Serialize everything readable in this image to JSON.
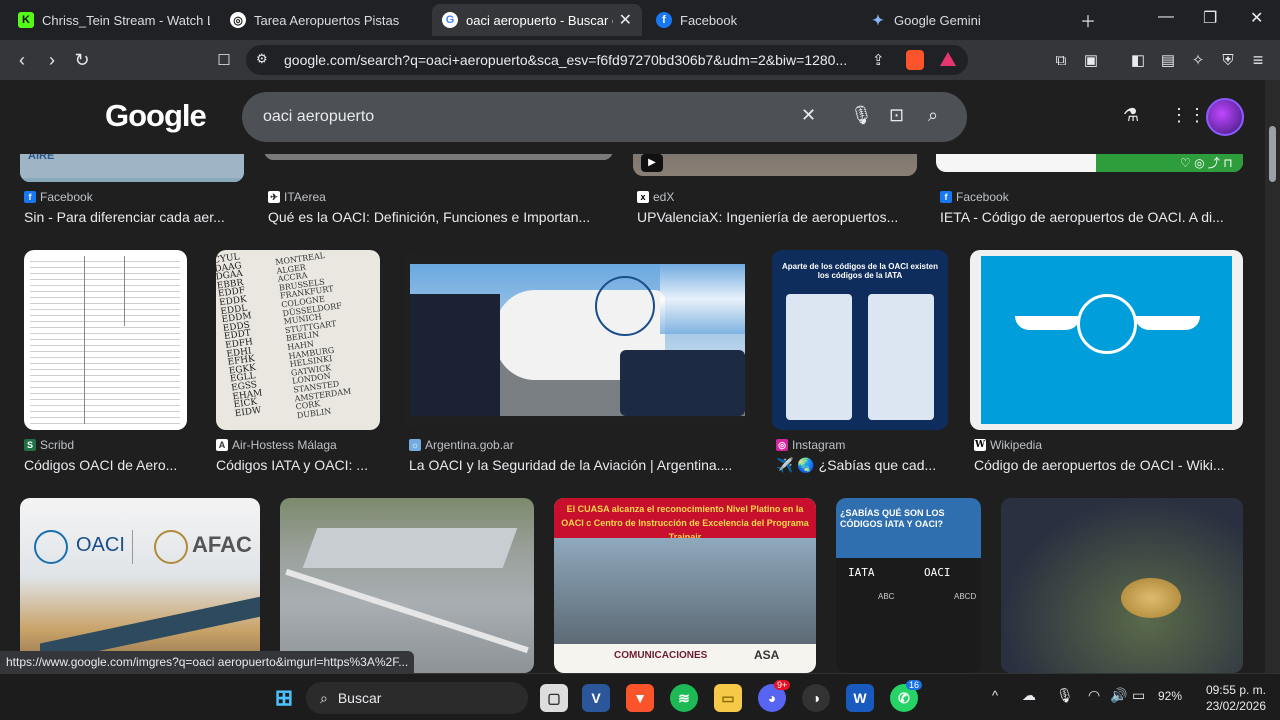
{
  "browser": {
    "tabs": [
      {
        "title": "Chriss_Tein Stream - Watch Live",
        "icon": "kick-icon",
        "active": false
      },
      {
        "title": "Tarea Aeropuertos Pistas",
        "icon": "docs-icon",
        "active": false
      },
      {
        "title": "oaci aeropuerto - Buscar con Google",
        "icon": "google-icon",
        "active": true
      },
      {
        "title": "Facebook",
        "icon": "facebook-icon",
        "active": false
      },
      {
        "title": "Google Gemini",
        "icon": "gemini-icon",
        "active": false
      }
    ],
    "url": "google.com/search?q=oaci+aeropuerto&sca_esv=f6fd97270bd306b7&udm=2&biw=1280...",
    "status_url": "https://www.google.com/imgres?q=oaci aeropuerto&imgurl=https%3A%2F..."
  },
  "google": {
    "logo": "Google",
    "query": "oaci aeropuerto"
  },
  "results": {
    "row1": [
      {
        "source": "Facebook",
        "caption": "Sin - Para diferenciar cada aer..."
      },
      {
        "source": "ITAerea",
        "caption": "Qué es la OACI: Definición, Funciones e Importan..."
      },
      {
        "source": "edX",
        "caption": "UPValenciaX: Ingeniería de aeropuertos..."
      },
      {
        "source": "Facebook",
        "caption": "IETA - Código de aeropuertos de OACI. A di..."
      }
    ],
    "row2": [
      {
        "source": "Scribd",
        "caption": "Códigos OACI de Aero..."
      },
      {
        "source": "Air-Hostess Málaga",
        "caption": "Códigos IATA y OACI: ..."
      },
      {
        "source": "Argentina.gob.ar",
        "caption": "La OACI y la Seguridad de la Aviación | Argentina...."
      },
      {
        "source": "Instagram",
        "caption": "✈️ 🌏 ¿Sabías que cad..."
      },
      {
        "source": "Wikipedia",
        "caption": "Código de aeropuertos de OACI - Wiki..."
      }
    ],
    "thumb_text": {
      "aire": "AIRE",
      "oaci": "OACI",
      "afac": "AFAC",
      "cuasa_banner": "El CUASA alcanza el reconocimiento Nivel Platino en la OACI c Centro de Instrucción de Excelencia del Programa Trainair",
      "comunicaciones": "COMUNICACIONES",
      "asa": "ASA",
      "sabias": "¿SABÍAS QUÉ SON LOS CÓDIGOS IATA Y OACI?",
      "iata": "IATA",
      "oaci2": "OACI",
      "abc": "ABC",
      "abcd": "ABCD",
      "insta_title": "Aparte de los códigos de la OACI existen los códigos de la IATA",
      "airport_codes": [
        "CYUL",
        "DAAG",
        "DGAA",
        "EBBR",
        "EDDF",
        "EDDK",
        "EDDL",
        "EDDM",
        "EDDS",
        "EDDT",
        "EDFH",
        "EDHI",
        "EFHK",
        "EGKK",
        "EGLL",
        "EGSS",
        "EHAM",
        "EICK",
        "EIDW"
      ],
      "cities": [
        "MONTREAL",
        "ALGER",
        "ACCRA",
        "BRUSSELS",
        "FRANKFURT",
        "COLOGNE",
        "DÜSSELDORF",
        "MUNICH",
        "STUTTGART",
        "BERLIN",
        "HAHN",
        "HAMBURG",
        "HELSINKI",
        "GATWICK",
        "LONDON",
        "STANSTED",
        "AMSTERDAM",
        "CORK",
        "DUBLIN"
      ]
    }
  },
  "taskbar": {
    "search_label": "Buscar",
    "battery": "92%",
    "time": "09:55 p. m.",
    "date": "23/02/2026",
    "discord_badge": "9+",
    "whatsapp_badge": "16"
  },
  "colors": {
    "bg": "#1f1f1f",
    "accent_green": "#1db954",
    "brave_orange": "#fb542b"
  }
}
